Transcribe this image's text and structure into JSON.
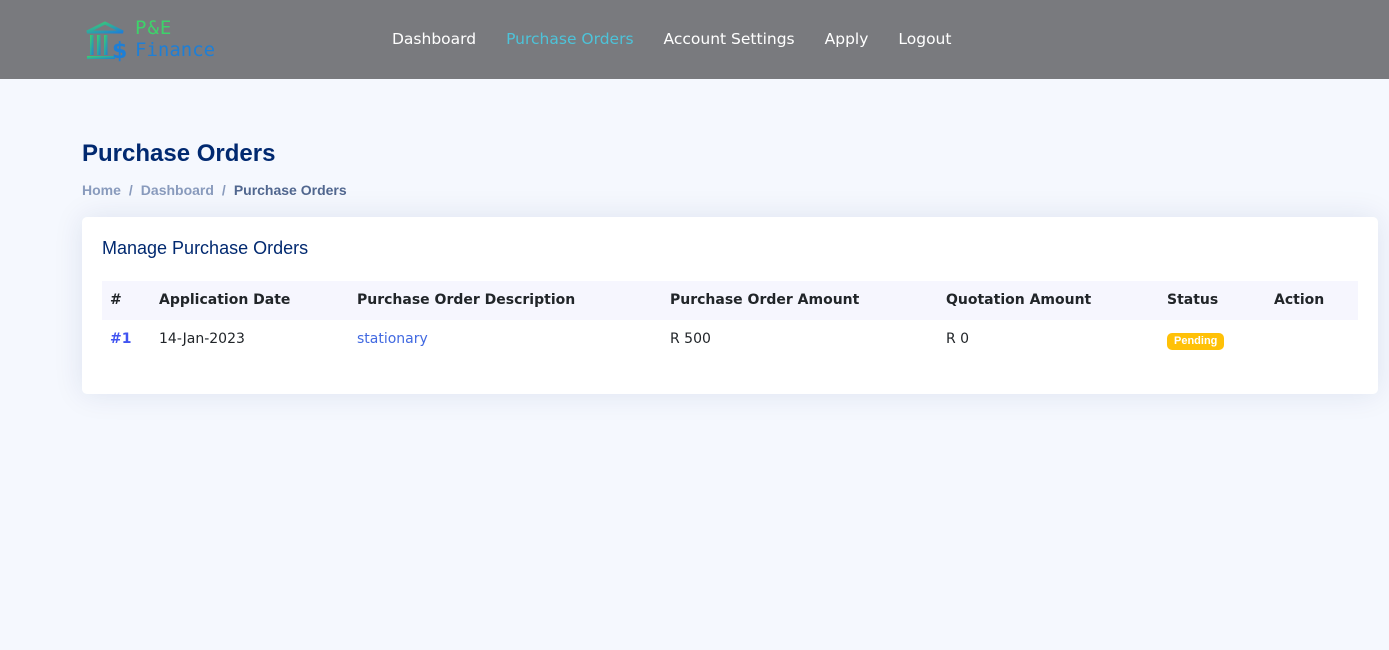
{
  "brand": {
    "top_text": "P&E",
    "bottom_text": "Finance",
    "icon": "bank-dollar-icon",
    "colors": {
      "green": "#3dd36a",
      "blue": "#1e7fd6"
    }
  },
  "nav": {
    "items": [
      {
        "label": "Dashboard",
        "active": false
      },
      {
        "label": "Purchase Orders",
        "active": true
      },
      {
        "label": "Account Settings",
        "active": false
      },
      {
        "label": "Apply",
        "active": false
      },
      {
        "label": "Logout",
        "active": false
      }
    ]
  },
  "page": {
    "title": "Purchase Orders",
    "breadcrumb": [
      "Home",
      "Dashboard",
      "Purchase Orders"
    ],
    "breadcrumb_separator": "/"
  },
  "card": {
    "title": "Manage Purchase Orders",
    "table": {
      "columns": [
        "#",
        "Application Date",
        "Purchase Order Description",
        "Purchase Order Amount",
        "Quotation Amount",
        "Status",
        "Action"
      ],
      "rows": [
        {
          "id": "#1",
          "date": "14-Jan-2023",
          "description": "stationary",
          "po_amount": "R 500",
          "quote_amount": "R 0",
          "status": "Pending",
          "action": ""
        }
      ]
    }
  },
  "colors": {
    "header_bg": "#797a7e",
    "page_bg": "#f5f8fe",
    "active_nav": "#4dc3d9",
    "title": "#012970",
    "link": "#4169e1",
    "pending_badge": "#ffc107"
  }
}
